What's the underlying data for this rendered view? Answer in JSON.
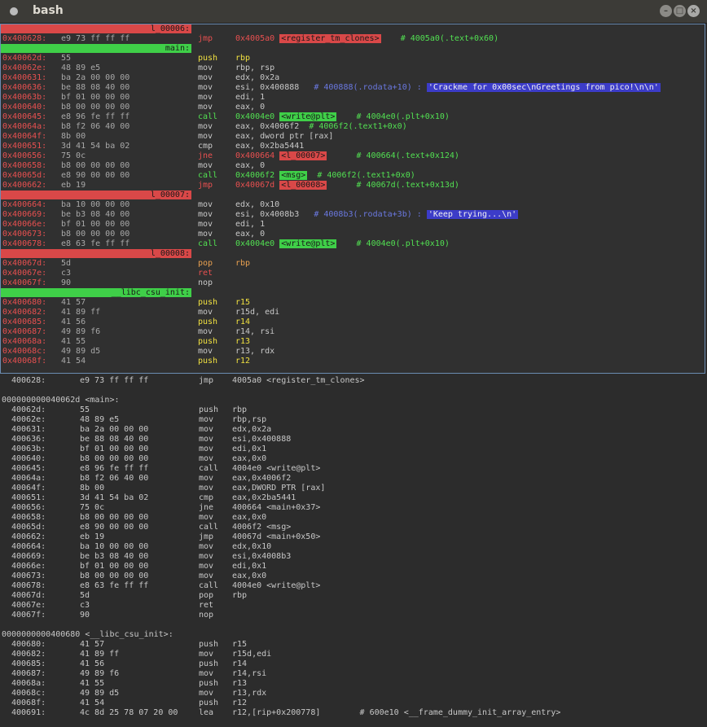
{
  "window": {
    "title": "bash"
  },
  "r2": {
    "lines": [
      {
        "type": "label",
        "text": "l_00006:",
        "color": "red"
      },
      {
        "addr": "0x400628:",
        "bytes": "e9 73 ff ff ff",
        "op": "jmp",
        "opc": "red",
        "args": [
          {
            "t": "0x4005a0 ",
            "c": "red"
          },
          {
            "t": "<register_tm_clones>",
            "c": "tag-red"
          },
          {
            "t": "    # 4005a0(.text+0x60)",
            "c": "green"
          }
        ]
      },
      {
        "type": "label",
        "text": "main:",
        "color": "green"
      },
      {
        "addr": "0x40062d:",
        "bytes": "55",
        "op": "push",
        "opc": "yellow",
        "args": [
          {
            "t": "rbp",
            "c": "yellow"
          }
        ]
      },
      {
        "addr": "0x40062e:",
        "bytes": "48 89 e5",
        "op": "mov",
        "opc": "gray",
        "args": [
          {
            "t": "rbp, rsp",
            "c": "gray"
          }
        ]
      },
      {
        "addr": "0x400631:",
        "bytes": "ba 2a 00 00 00",
        "op": "mov",
        "opc": "gray",
        "args": [
          {
            "t": "edx, 0x2a",
            "c": "gray"
          }
        ]
      },
      {
        "addr": "0x400636:",
        "bytes": "be 88 08 40 00",
        "op": "mov",
        "opc": "gray",
        "args": [
          {
            "t": "esi, 0x400888   ",
            "c": "gray"
          },
          {
            "t": "# 400888(.rodata+10) : ",
            "c": "blue"
          },
          {
            "t": "'Crackme for 0x00sec\\nGreetings from pico!\\n\\n'",
            "c": "str"
          }
        ]
      },
      {
        "addr": "0x40063b:",
        "bytes": "bf 01 00 00 00",
        "op": "mov",
        "opc": "gray",
        "args": [
          {
            "t": "edi, 1",
            "c": "gray"
          }
        ]
      },
      {
        "addr": "0x400640:",
        "bytes": "b8 00 00 00 00",
        "op": "mov",
        "opc": "gray",
        "args": [
          {
            "t": "eax, 0",
            "c": "gray"
          }
        ]
      },
      {
        "addr": "0x400645:",
        "bytes": "e8 96 fe ff ff",
        "op": "call",
        "opc": "green",
        "args": [
          {
            "t": "0x4004e0 ",
            "c": "green"
          },
          {
            "t": "<write@plt>",
            "c": "tag-green"
          },
          {
            "t": "    # 4004e0(.plt+0x10)",
            "c": "green"
          }
        ]
      },
      {
        "addr": "0x40064a:",
        "bytes": "b8 f2 06 40 00",
        "op": "mov",
        "opc": "gray",
        "args": [
          {
            "t": "eax, 0x4006f2  ",
            "c": "gray"
          },
          {
            "t": "# 4006f2(.text1+0x0)",
            "c": "green"
          }
        ]
      },
      {
        "addr": "0x40064f:",
        "bytes": "8b 00",
        "op": "mov",
        "opc": "gray",
        "args": [
          {
            "t": "eax, dword ptr [rax]",
            "c": "gray"
          }
        ]
      },
      {
        "addr": "0x400651:",
        "bytes": "3d 41 54 ba 02",
        "op": "cmp",
        "opc": "gray",
        "args": [
          {
            "t": "eax, 0x2ba5441",
            "c": "gray"
          }
        ]
      },
      {
        "addr": "0x400656:",
        "bytes": "75 0c",
        "op": "jne",
        "opc": "red",
        "args": [
          {
            "t": "0x400664 ",
            "c": "red"
          },
          {
            "t": "<l_00007>",
            "c": "tag-red"
          },
          {
            "t": "      # 400664(.text+0x124)",
            "c": "green"
          }
        ]
      },
      {
        "addr": "0x400658:",
        "bytes": "b8 00 00 00 00",
        "op": "mov",
        "opc": "gray",
        "args": [
          {
            "t": "eax, 0",
            "c": "gray"
          }
        ]
      },
      {
        "addr": "0x40065d:",
        "bytes": "e8 90 00 00 00",
        "op": "call",
        "opc": "green",
        "args": [
          {
            "t": "0x4006f2 ",
            "c": "green"
          },
          {
            "t": "<msg>",
            "c": "tag-green"
          },
          {
            "t": "  # 4006f2(.text1+0x0)",
            "c": "green"
          }
        ]
      },
      {
        "addr": "0x400662:",
        "bytes": "eb 19",
        "op": "jmp",
        "opc": "red",
        "args": [
          {
            "t": "0x40067d ",
            "c": "red"
          },
          {
            "t": "<l_00008>",
            "c": "tag-red"
          },
          {
            "t": "      # 40067d(.text+0x13d)",
            "c": "green"
          }
        ]
      },
      {
        "type": "label",
        "text": "l_00007:",
        "color": "red"
      },
      {
        "addr": "0x400664:",
        "bytes": "ba 10 00 00 00",
        "op": "mov",
        "opc": "gray",
        "args": [
          {
            "t": "edx, 0x10",
            "c": "gray"
          }
        ]
      },
      {
        "addr": "0x400669:",
        "bytes": "be b3 08 40 00",
        "op": "mov",
        "opc": "gray",
        "args": [
          {
            "t": "esi, 0x4008b3   ",
            "c": "gray"
          },
          {
            "t": "# 4008b3(.rodata+3b) : ",
            "c": "blue"
          },
          {
            "t": "'Keep trying...\\n'",
            "c": "str"
          }
        ]
      },
      {
        "addr": "0x40066e:",
        "bytes": "bf 01 00 00 00",
        "op": "mov",
        "opc": "gray",
        "args": [
          {
            "t": "edi, 1",
            "c": "gray"
          }
        ]
      },
      {
        "addr": "0x400673:",
        "bytes": "b8 00 00 00 00",
        "op": "mov",
        "opc": "gray",
        "args": [
          {
            "t": "eax, 0",
            "c": "gray"
          }
        ]
      },
      {
        "addr": "0x400678:",
        "bytes": "e8 63 fe ff ff",
        "op": "call",
        "opc": "green",
        "args": [
          {
            "t": "0x4004e0 ",
            "c": "green"
          },
          {
            "t": "<write@plt>",
            "c": "tag-green"
          },
          {
            "t": "    # 4004e0(.plt+0x10)",
            "c": "green"
          }
        ]
      },
      {
        "type": "label",
        "text": "l_00008:",
        "color": "red"
      },
      {
        "addr": "0x40067d:",
        "bytes": "5d",
        "op": "pop",
        "opc": "orange",
        "args": [
          {
            "t": "rbp",
            "c": "orange"
          }
        ]
      },
      {
        "addr": "0x40067e:",
        "bytes": "c3",
        "op": "ret",
        "opc": "red",
        "args": []
      },
      {
        "addr": "0x40067f:",
        "bytes": "90",
        "op": "nop",
        "opc": "gray",
        "args": []
      },
      {
        "type": "label",
        "text": "__libc_csu_init:",
        "color": "green"
      },
      {
        "addr": "0x400680:",
        "bytes": "41 57",
        "op": "push",
        "opc": "yellow",
        "args": [
          {
            "t": "r15",
            "c": "yellow"
          }
        ]
      },
      {
        "addr": "0x400682:",
        "bytes": "41 89 ff",
        "op": "mov",
        "opc": "gray",
        "args": [
          {
            "t": "r15d, edi",
            "c": "gray"
          }
        ]
      },
      {
        "addr": "0x400685:",
        "bytes": "41 56",
        "op": "push",
        "opc": "yellow",
        "args": [
          {
            "t": "r14",
            "c": "yellow"
          }
        ]
      },
      {
        "addr": "0x400687:",
        "bytes": "49 89 f6",
        "op": "mov",
        "opc": "gray",
        "args": [
          {
            "t": "r14, rsi",
            "c": "gray"
          }
        ]
      },
      {
        "addr": "0x40068a:",
        "bytes": "41 55",
        "op": "push",
        "opc": "yellow",
        "args": [
          {
            "t": "r13",
            "c": "yellow"
          }
        ]
      },
      {
        "addr": "0x40068c:",
        "bytes": "49 89 d5",
        "op": "mov",
        "opc": "gray",
        "args": [
          {
            "t": "r13, rdx",
            "c": "gray"
          }
        ]
      },
      {
        "addr": "0x40068f:",
        "bytes": "41 54",
        "op": "push",
        "opc": "yellow",
        "args": [
          {
            "t": "r12",
            "c": "yellow"
          }
        ]
      }
    ]
  },
  "dump": {
    "lines": [
      {
        "addr": "400628:",
        "bytes": "e9 73 ff ff ff",
        "op": "jmp",
        "args": "4005a0 <register_tm_clones>",
        "row": 0
      },
      {
        "head": "000000000040062d <main>:",
        "row": 2
      },
      {
        "addr": "40062d:",
        "bytes": "55",
        "op": "push",
        "args": "rbp",
        "row": 3
      },
      {
        "addr": "40062e:",
        "bytes": "48 89 e5",
        "op": "mov",
        "args": "rbp,rsp",
        "row": 4
      },
      {
        "addr": "400631:",
        "bytes": "ba 2a 00 00 00",
        "op": "mov",
        "args": "edx,0x2a",
        "row": 5
      },
      {
        "addr": "400636:",
        "bytes": "be 88 08 40 00",
        "op": "mov",
        "args": "esi,0x400888",
        "row": 6
      },
      {
        "addr": "40063b:",
        "bytes": "bf 01 00 00 00",
        "op": "mov",
        "args": "edi,0x1",
        "row": 7
      },
      {
        "addr": "400640:",
        "bytes": "b8 00 00 00 00",
        "op": "mov",
        "args": "eax,0x0",
        "row": 8
      },
      {
        "addr": "400645:",
        "bytes": "e8 96 fe ff ff",
        "op": "call",
        "args": "4004e0 <write@plt>",
        "row": 9
      },
      {
        "addr": "40064a:",
        "bytes": "b8 f2 06 40 00",
        "op": "mov",
        "args": "eax,0x4006f2",
        "row": 10
      },
      {
        "addr": "40064f:",
        "bytes": "8b 00",
        "op": "mov",
        "args": "eax,DWORD PTR [rax]",
        "row": 11
      },
      {
        "addr": "400651:",
        "bytes": "3d 41 54 ba 02",
        "op": "cmp",
        "args": "eax,0x2ba5441",
        "row": 12
      },
      {
        "addr": "400656:",
        "bytes": "75 0c",
        "op": "jne",
        "args": "400664 <main+0x37>",
        "row": 13
      },
      {
        "addr": "400658:",
        "bytes": "b8 00 00 00 00",
        "op": "mov",
        "args": "eax,0x0",
        "row": 14
      },
      {
        "addr": "40065d:",
        "bytes": "e8 90 00 00 00",
        "op": "call",
        "args": "4006f2 <msg>",
        "row": 15
      },
      {
        "addr": "400662:",
        "bytes": "eb 19",
        "op": "jmp",
        "args": "40067d <main+0x50>",
        "row": 16
      },
      {
        "addr": "400664:",
        "bytes": "ba 10 00 00 00",
        "op": "mov",
        "args": "edx,0x10",
        "row": 17
      },
      {
        "addr": "400669:",
        "bytes": "be b3 08 40 00",
        "op": "mov",
        "args": "esi,0x4008b3",
        "row": 18
      },
      {
        "addr": "40066e:",
        "bytes": "bf 01 00 00 00",
        "op": "mov",
        "args": "edi,0x1",
        "row": 19
      },
      {
        "addr": "400673:",
        "bytes": "b8 00 00 00 00",
        "op": "mov",
        "args": "eax,0x0",
        "row": 20
      },
      {
        "addr": "400678:",
        "bytes": "e8 63 fe ff ff",
        "op": "call",
        "args": "4004e0 <write@plt>",
        "row": 21
      },
      {
        "addr": "40067d:",
        "bytes": "5d",
        "op": "pop",
        "args": "rbp",
        "row": 22
      },
      {
        "addr": "40067e:",
        "bytes": "c3",
        "op": "ret",
        "args": "",
        "row": 23
      },
      {
        "addr": "40067f:",
        "bytes": "90",
        "op": "nop",
        "args": "",
        "row": 24
      },
      {
        "head": "0000000000400680 <__libc_csu_init>:",
        "row": 26
      },
      {
        "addr": "400680:",
        "bytes": "41 57",
        "op": "push",
        "args": "r15",
        "row": 27
      },
      {
        "addr": "400682:",
        "bytes": "41 89 ff",
        "op": "mov",
        "args": "r15d,edi",
        "row": 28
      },
      {
        "addr": "400685:",
        "bytes": "41 56",
        "op": "push",
        "args": "r14",
        "row": 29
      },
      {
        "addr": "400687:",
        "bytes": "49 89 f6",
        "op": "mov",
        "args": "r14,rsi",
        "row": 30
      },
      {
        "addr": "40068a:",
        "bytes": "41 55",
        "op": "push",
        "args": "r13",
        "row": 31
      },
      {
        "addr": "40068c:",
        "bytes": "49 89 d5",
        "op": "mov",
        "args": "r13,rdx",
        "row": 32
      },
      {
        "addr": "40068f:",
        "bytes": "41 54",
        "op": "push",
        "args": "r12",
        "row": 33
      },
      {
        "addr": "400691:",
        "bytes": "4c 8d 25 78 07 20 00",
        "op": "lea",
        "args": "r12,[rip+0x200778]        # 600e10 <__frame_dummy_init_array_entry>",
        "row": 34
      }
    ]
  },
  "colors": {
    "red": "#e85050",
    "green": "#52e052",
    "yellow": "#f0e040",
    "blue": "#6a78e0",
    "border": "#6b8cb2"
  }
}
